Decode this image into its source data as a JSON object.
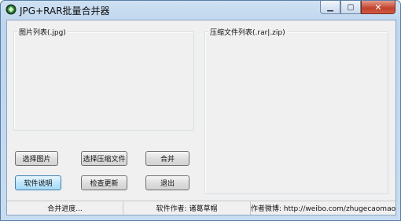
{
  "window": {
    "title": "JPG+RAR批量合并器",
    "minimize_icon": "minimize-icon",
    "maximize_icon": "maximize-icon",
    "close_icon": "close-icon"
  },
  "groups": {
    "images_label": "图片列表(.jpg)",
    "archives_label": "压缩文件列表(.rar|.zip)"
  },
  "buttons": {
    "select_images": "选择图片",
    "select_archive": "选择压缩文件",
    "merge": "合并",
    "software_info": "软件说明",
    "check_update": "检查更新",
    "exit": "退出"
  },
  "status": {
    "progress": "合并进度...",
    "author": "软件作者: 诸葛草帽",
    "weibo": "作者微博: http://weibo.com/zhugecaomao"
  },
  "colors": {
    "titlebar": "#bdd5ee",
    "client": "#f0f0f0",
    "close_button": "#c0412b",
    "focus_button": "#a7d9f5"
  }
}
